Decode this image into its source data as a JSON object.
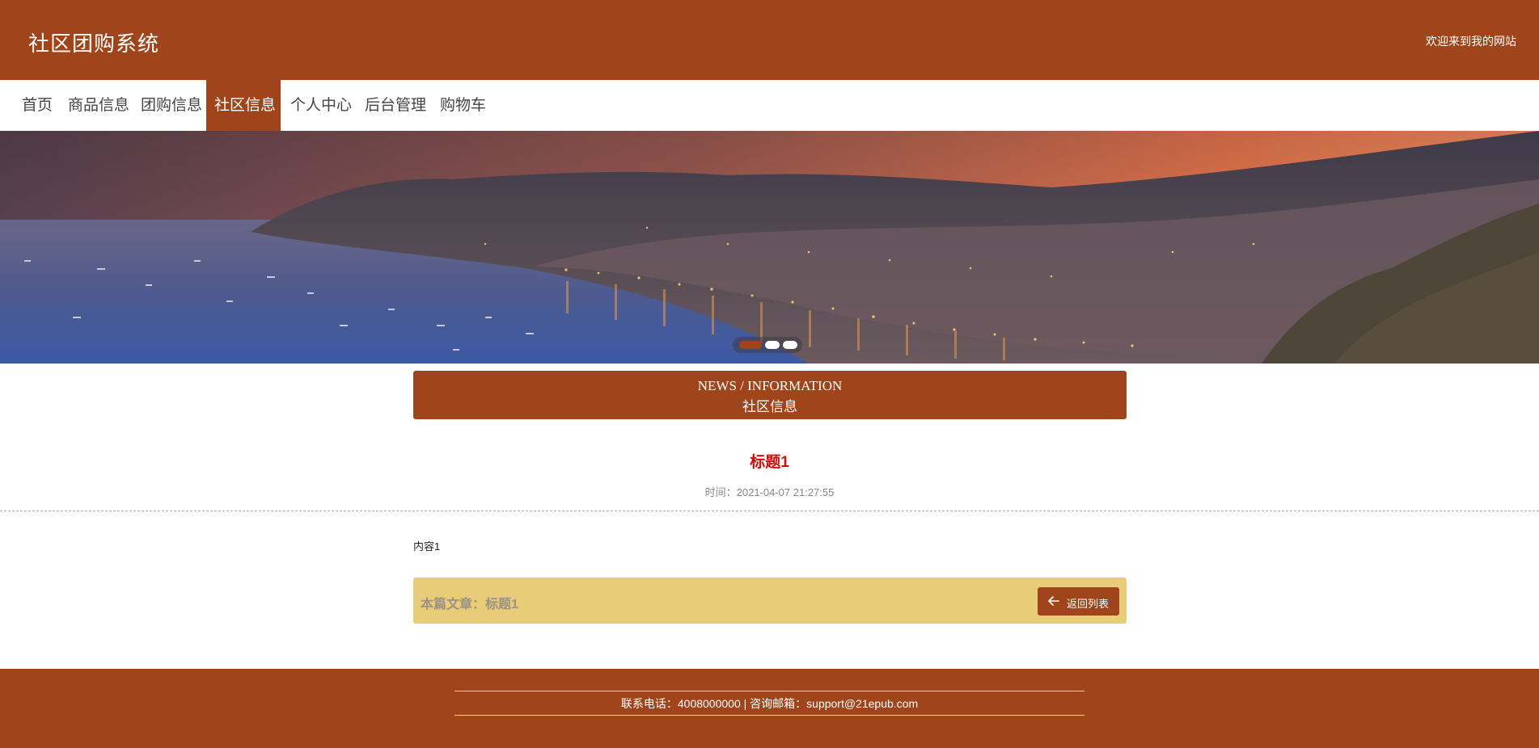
{
  "header": {
    "site_title": "社区团购系统",
    "welcome_text": "欢迎来到我的网站"
  },
  "nav": {
    "items": [
      {
        "label": "首页",
        "active": false
      },
      {
        "label": "商品信息",
        "active": false
      },
      {
        "label": "团购信息",
        "active": false
      },
      {
        "label": "社区信息",
        "active": true
      },
      {
        "label": "个人中心",
        "active": false
      },
      {
        "label": "后台管理",
        "active": false
      },
      {
        "label": "购物车",
        "active": false
      }
    ]
  },
  "banner": {
    "slide_count": 3,
    "active_slide": 1
  },
  "section": {
    "title_en": "NEWS / INFORMATION",
    "title_cn": "社区信息"
  },
  "article": {
    "title": "标题1",
    "time": "时间：2021-04-07 21:27:55",
    "content": "内容1",
    "current_label": "本篇文章：标题1",
    "back_button_label": "返回列表",
    "back_icon": "arrow-left-icon"
  },
  "footer": {
    "contact": "联系电话：4008000000 | 咨询邮箱：support@21epub.com"
  },
  "colors": {
    "brand": "#a0451b",
    "article_title": "#d00c0c",
    "article_footer_bg": "#e8cc78",
    "white": "#ffffff"
  }
}
